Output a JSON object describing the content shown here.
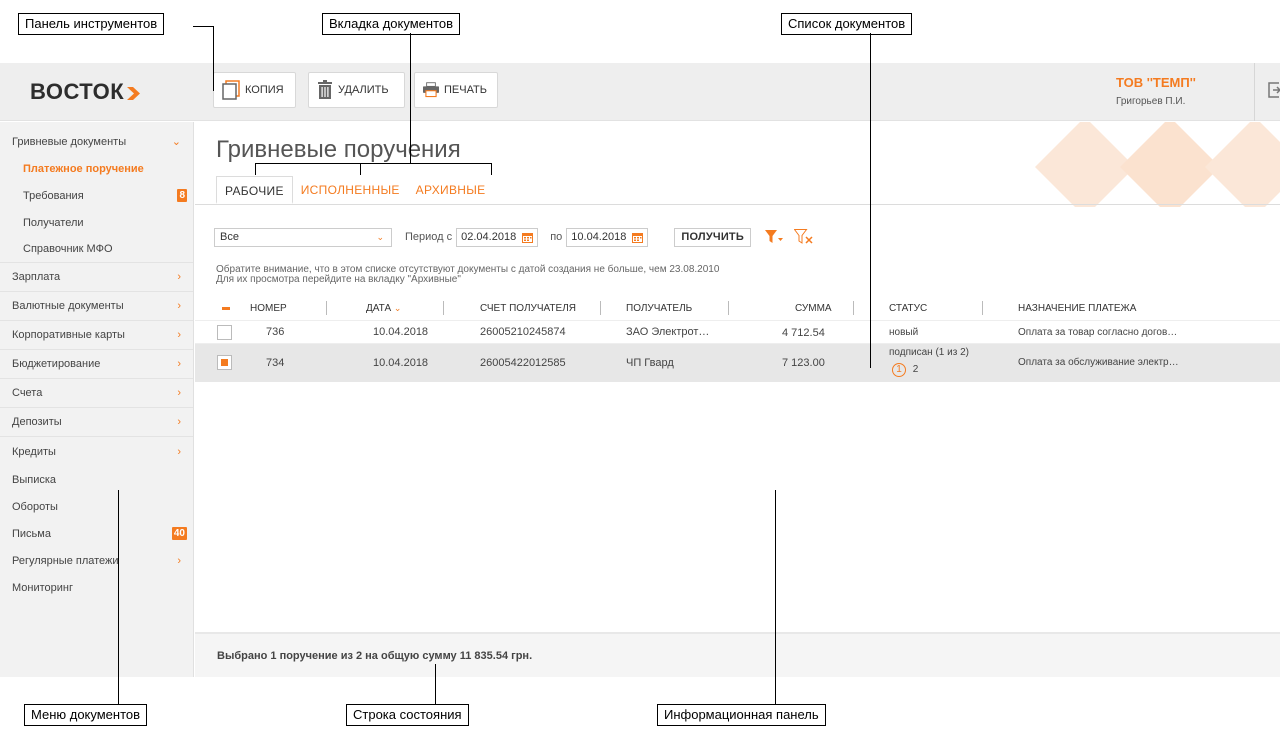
{
  "callouts": {
    "toolbar": "Панель инструментов",
    "doc_tabs": "Вкладка документов",
    "doc_list": "Список документов",
    "doc_menu": "Меню документов",
    "status_line": "Строка состояния",
    "info_panel": "Информационная панель"
  },
  "brand": {
    "name": "ВОСТОК",
    "accent": "#f47b20"
  },
  "toolbar": {
    "copy_label": "КОПИЯ",
    "delete_label": "УДАЛИТЬ",
    "print_label": "ПЕЧАТЬ"
  },
  "user": {
    "company": "ТОВ ''ТЕМП''",
    "name": "Григорьев П.И."
  },
  "sidebar": {
    "groups": [
      {
        "label": "Гривневые документы",
        "expanded": true
      },
      {
        "label": "Зарплата"
      },
      {
        "label": "Валютные документы"
      },
      {
        "label": "Корпоративные карты"
      },
      {
        "label": "Бюджетирование"
      },
      {
        "label": "Счета"
      },
      {
        "label": "Депозиты"
      },
      {
        "label": "Кредиты"
      },
      {
        "label": "Выписка"
      },
      {
        "label": "Обороты"
      },
      {
        "label": "Письма",
        "badge": "40"
      },
      {
        "label": "Регулярные платежи"
      },
      {
        "label": "Мониторинг"
      }
    ],
    "subitems": [
      {
        "label": "Платежное поручение",
        "active": true
      },
      {
        "label": "Требования",
        "badge": "8"
      },
      {
        "label": "Получатели"
      },
      {
        "label": "Справочник МФО"
      }
    ]
  },
  "page": {
    "title": "Гривневые поручения",
    "tabs": [
      "РАБОЧИЕ",
      "ИСПОЛНЕННЫЕ",
      "АРХИВНЫЕ"
    ]
  },
  "filter": {
    "select_value": "Все",
    "period_from_label": "Период с",
    "date_from": "02.04.2018",
    "period_to_label": "по",
    "date_to": "10.04.2018",
    "get_label": "ПОЛУЧИТЬ"
  },
  "notice": {
    "line1": "Обратите внимание, что в этом списке отсутствуют документы с датой создания не больше, чем 23.08.2010",
    "line2": "Для их просмотра перейдите на вкладку \"Архивные\""
  },
  "table": {
    "columns": [
      "НОМЕР",
      "ДАТА",
      "СЧЕТ ПОЛУЧАТЕЛЯ",
      "ПОЛУЧАТЕЛЬ",
      "СУММА",
      "СТАТУС",
      "НАЗНАЧЕНИЕ ПЛАТЕЖА"
    ],
    "rows": [
      {
        "number": "736",
        "date": "10.04.2018",
        "account": "26005210245874",
        "recipient": "ЗАО Электрот…",
        "amount": "4 712.54",
        "status": "новый",
        "purpose": "Оплата за товар согласно догов…",
        "checked": false
      },
      {
        "number": "734",
        "date": "10.04.2018",
        "account": "26005422012585",
        "recipient": "ЧП Гвард",
        "amount": "7 123.00",
        "status": "подписан (1 из 2)",
        "sign_1": "1",
        "sign_2": "2",
        "purpose": "Оплата за обслуживание электр…",
        "checked": true
      }
    ]
  },
  "status": {
    "text": "Выбрано 1 поручение из 2 на общую сумму 11 835.54 грн."
  }
}
